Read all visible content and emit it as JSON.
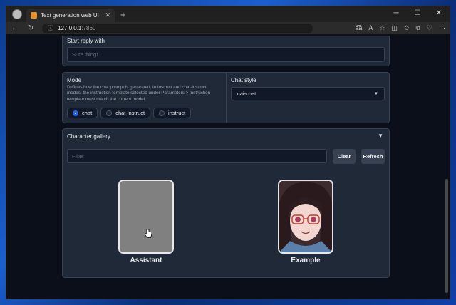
{
  "browser": {
    "tab_title": "Text generation web UI",
    "new_tab": "+",
    "url_host": "127.0.0.1",
    "url_port": ":7860",
    "window_controls": [
      "─",
      "☐",
      "✕"
    ],
    "nav_icons": [
      "back-icon",
      "refresh-icon"
    ],
    "toolbar_icons": [
      "read-aloud-icon",
      "text-size-icon",
      "favorite-icon",
      "split-screen-icon",
      "favorites-icon",
      "collections-icon",
      "copilot-icon",
      "more-icon"
    ]
  },
  "start_reply": {
    "label": "Start reply with",
    "placeholder": "Sure thing!"
  },
  "mode": {
    "label": "Mode",
    "description": "Defines how the chat prompt is generated. In instruct and chat-instruct modes, the instruction template selected under Parameters > Instruction template must match the current model.",
    "options": [
      "chat",
      "chat-instruct",
      "instruct"
    ],
    "selected": "chat"
  },
  "chat_style": {
    "label": "Chat style",
    "value": "cai-chat"
  },
  "gallery": {
    "title": "Character gallery",
    "filter_placeholder": "Filter",
    "clear_label": "Clear",
    "refresh_label": "Refresh",
    "characters": [
      "Assistant",
      "Example"
    ]
  },
  "colors": {
    "page_bg": "#0b0f19",
    "panel_bg": "#1f2937",
    "accent": "#2563eb"
  }
}
